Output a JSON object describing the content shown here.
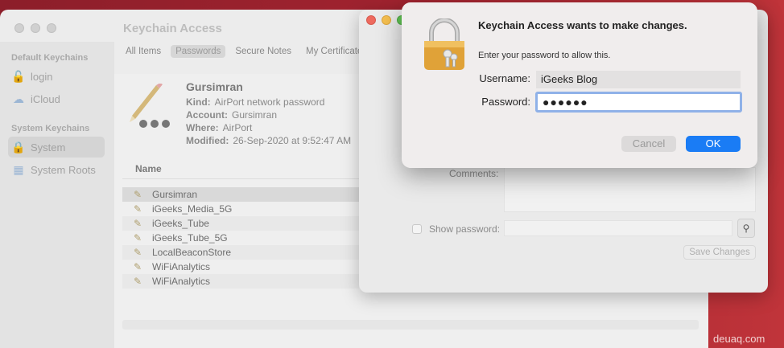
{
  "main_window": {
    "title": "Keychain Access",
    "sidebar": {
      "default_header": "Default Keychains",
      "default_items": [
        {
          "label": "login",
          "icon": "lock-icon"
        },
        {
          "label": "iCloud",
          "icon": "cloud-icon"
        }
      ],
      "system_header": "System Keychains",
      "system_items": [
        {
          "label": "System",
          "icon": "lock-icon",
          "selected": true
        },
        {
          "label": "System Roots",
          "icon": "cabinet-icon"
        }
      ]
    },
    "tabs": [
      "All Items",
      "Passwords",
      "Secure Notes",
      "My Certificate"
    ],
    "active_tab": "Passwords",
    "detail": {
      "name": "Gursimran",
      "kind_label": "Kind:",
      "kind_value": "AirPort network password",
      "account_label": "Account:",
      "account_value": "Gursimran",
      "where_label": "Where:",
      "where_value": "AirPort",
      "modified_label": "Modified:",
      "modified_value": "26-Sep-2020 at 9:52:47 AM"
    },
    "list": {
      "header": "Name",
      "rows": [
        "Gursimran",
        "iGeeks_Media_5G",
        "iGeeks_Tube",
        "iGeeks_Tube_5G",
        "LocalBeaconStore",
        "WiFiAnalytics",
        "WiFiAnalytics"
      ],
      "selected_index": 0
    }
  },
  "item_window": {
    "comments_label": "Comments:",
    "show_password_label": "Show password:",
    "save_button": "Save Changes"
  },
  "dialog": {
    "title": "Keychain Access wants to make changes.",
    "subtitle": "Enter your password to allow this.",
    "username_label": "Username:",
    "username_value": "iGeeks Blog",
    "password_label": "Password:",
    "password_value": "●●●●●●",
    "cancel": "Cancel",
    "ok": "OK",
    "ok_color": "#1a7cf5"
  },
  "watermark": "deuaq.com"
}
